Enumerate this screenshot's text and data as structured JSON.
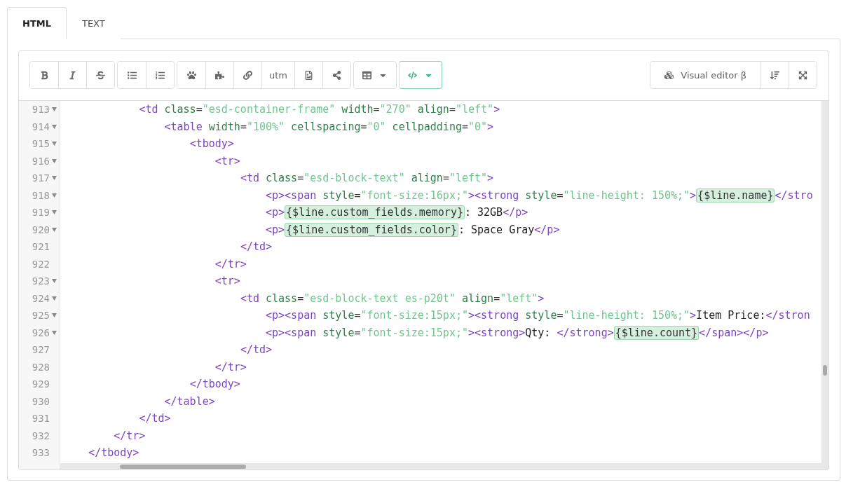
{
  "tabs": [
    {
      "label": "HTML",
      "selected": true
    },
    {
      "label": "TEXT",
      "selected": false
    }
  ],
  "toolbar": {
    "utm_label": "utm",
    "code_view": {
      "selected": true
    },
    "visual_editor_label": "Visual editor β"
  },
  "code_lines": [
    {
      "number": "913",
      "foldable": true,
      "tokens": [
        {
          "kind": "tag",
          "text": "            <td"
        },
        {
          "kind": "attr",
          "text": " class"
        },
        {
          "kind": "punct",
          "text": "="
        },
        {
          "kind": "value",
          "text": "\"esd-container-frame\""
        },
        {
          "kind": "attr",
          "text": " width"
        },
        {
          "kind": "punct",
          "text": "="
        },
        {
          "kind": "value",
          "text": "\"270\""
        },
        {
          "kind": "attr",
          "text": " align"
        },
        {
          "kind": "punct",
          "text": "="
        },
        {
          "kind": "value",
          "text": "\"left\""
        },
        {
          "kind": "tag",
          "text": ">"
        }
      ]
    },
    {
      "number": "914",
      "foldable": true,
      "tokens": [
        {
          "kind": "tag",
          "text": "                <table"
        },
        {
          "kind": "attr",
          "text": " width"
        },
        {
          "kind": "punct",
          "text": "="
        },
        {
          "kind": "value",
          "text": "\"100%\""
        },
        {
          "kind": "attr",
          "text": " cellspacing"
        },
        {
          "kind": "punct",
          "text": "="
        },
        {
          "kind": "value",
          "text": "\"0\""
        },
        {
          "kind": "attr",
          "text": " cellpadding"
        },
        {
          "kind": "punct",
          "text": "="
        },
        {
          "kind": "value",
          "text": "\"0\""
        },
        {
          "kind": "tag",
          "text": ">"
        }
      ]
    },
    {
      "number": "915",
      "foldable": true,
      "tokens": [
        {
          "kind": "tag",
          "text": "                    <tbody>"
        }
      ]
    },
    {
      "number": "916",
      "foldable": true,
      "tokens": [
        {
          "kind": "tag",
          "text": "                        <tr>"
        }
      ]
    },
    {
      "number": "917",
      "foldable": true,
      "tokens": [
        {
          "kind": "tag",
          "text": "                            <td"
        },
        {
          "kind": "attr",
          "text": " class"
        },
        {
          "kind": "punct",
          "text": "="
        },
        {
          "kind": "value",
          "text": "\"esd-block-text\""
        },
        {
          "kind": "attr",
          "text": " align"
        },
        {
          "kind": "punct",
          "text": "="
        },
        {
          "kind": "value",
          "text": "\"left\""
        },
        {
          "kind": "tag",
          "text": ">"
        }
      ]
    },
    {
      "number": "918",
      "foldable": true,
      "tokens": [
        {
          "kind": "tag",
          "text": "                                <p><span"
        },
        {
          "kind": "attr",
          "text": " style"
        },
        {
          "kind": "punct",
          "text": "="
        },
        {
          "kind": "value",
          "text": "\"font-size:16px;\""
        },
        {
          "kind": "tag",
          "text": "><strong"
        },
        {
          "kind": "attr",
          "text": " style"
        },
        {
          "kind": "punct",
          "text": "="
        },
        {
          "kind": "value",
          "text": "\"line-height: 150%;\""
        },
        {
          "kind": "tag",
          "text": ">"
        },
        {
          "kind": "var",
          "text": "{$line.name}"
        },
        {
          "kind": "tag",
          "text": "</stro"
        }
      ]
    },
    {
      "number": "919",
      "foldable": true,
      "tokens": [
        {
          "kind": "tag",
          "text": "                                <p>"
        },
        {
          "kind": "var",
          "text": "{$line.custom_fields.memory}"
        },
        {
          "kind": "text",
          "text": ": 32GB"
        },
        {
          "kind": "tag",
          "text": "</p>"
        }
      ]
    },
    {
      "number": "920",
      "foldable": true,
      "tokens": [
        {
          "kind": "tag",
          "text": "                                <p>"
        },
        {
          "kind": "var",
          "text": "{$line.custom_fields.color}"
        },
        {
          "kind": "text",
          "text": ": Space Gray"
        },
        {
          "kind": "tag",
          "text": "</p>"
        }
      ]
    },
    {
      "number": "921",
      "foldable": false,
      "tokens": [
        {
          "kind": "tag",
          "text": "                            </td>"
        }
      ]
    },
    {
      "number": "922",
      "foldable": false,
      "tokens": [
        {
          "kind": "tag",
          "text": "                        </tr>"
        }
      ]
    },
    {
      "number": "923",
      "foldable": true,
      "tokens": [
        {
          "kind": "tag",
          "text": "                        <tr>"
        }
      ]
    },
    {
      "number": "924",
      "foldable": true,
      "tokens": [
        {
          "kind": "tag",
          "text": "                            <td"
        },
        {
          "kind": "attr",
          "text": " class"
        },
        {
          "kind": "punct",
          "text": "="
        },
        {
          "kind": "value",
          "text": "\"esd-block-text es-p20t\""
        },
        {
          "kind": "attr",
          "text": " align"
        },
        {
          "kind": "punct",
          "text": "="
        },
        {
          "kind": "value",
          "text": "\"left\""
        },
        {
          "kind": "tag",
          "text": ">"
        }
      ]
    },
    {
      "number": "925",
      "foldable": true,
      "tokens": [
        {
          "kind": "tag",
          "text": "                                <p><span"
        },
        {
          "kind": "attr",
          "text": " style"
        },
        {
          "kind": "punct",
          "text": "="
        },
        {
          "kind": "value",
          "text": "\"font-size:15px;\""
        },
        {
          "kind": "tag",
          "text": "><strong"
        },
        {
          "kind": "attr",
          "text": " style"
        },
        {
          "kind": "punct",
          "text": "="
        },
        {
          "kind": "value",
          "text": "\"line-height: 150%;\""
        },
        {
          "kind": "tag",
          "text": ">"
        },
        {
          "kind": "text",
          "text": "Item Price:"
        },
        {
          "kind": "tag",
          "text": "</stron"
        }
      ]
    },
    {
      "number": "926",
      "foldable": true,
      "tokens": [
        {
          "kind": "tag",
          "text": "                                <p><span"
        },
        {
          "kind": "attr",
          "text": " style"
        },
        {
          "kind": "punct",
          "text": "="
        },
        {
          "kind": "value",
          "text": "\"font-size:15px;\""
        },
        {
          "kind": "tag",
          "text": "><strong>"
        },
        {
          "kind": "text",
          "text": "Qty: "
        },
        {
          "kind": "tag",
          "text": "</strong>"
        },
        {
          "kind": "var",
          "text": "{$line.count}"
        },
        {
          "kind": "tag",
          "text": "</span></p>"
        }
      ]
    },
    {
      "number": "927",
      "foldable": false,
      "tokens": [
        {
          "kind": "tag",
          "text": "                            </td>"
        }
      ]
    },
    {
      "number": "928",
      "foldable": false,
      "tokens": [
        {
          "kind": "tag",
          "text": "                        </tr>"
        }
      ]
    },
    {
      "number": "929",
      "foldable": false,
      "tokens": [
        {
          "kind": "tag",
          "text": "                    </tbody>"
        }
      ]
    },
    {
      "number": "930",
      "foldable": false,
      "tokens": [
        {
          "kind": "tag",
          "text": "                </table>"
        }
      ]
    },
    {
      "number": "931",
      "foldable": false,
      "tokens": [
        {
          "kind": "tag",
          "text": "            </td>"
        }
      ]
    },
    {
      "number": "932",
      "foldable": false,
      "tokens": [
        {
          "kind": "tag",
          "text": "        </tr>"
        }
      ]
    },
    {
      "number": "933",
      "foldable": false,
      "tokens": [
        {
          "kind": "tag",
          "text": "    </tbody>"
        }
      ]
    }
  ]
}
